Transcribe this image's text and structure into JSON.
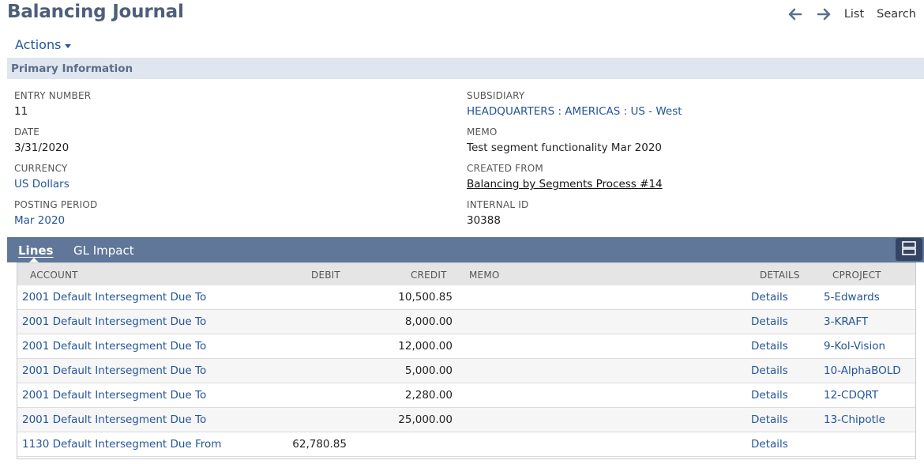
{
  "page": {
    "title": "Balancing Journal",
    "nav": {
      "back_icon": "arrow-left-icon",
      "forward_icon": "arrow-right-icon",
      "list": "List",
      "search": "Search"
    },
    "actions_label": "Actions"
  },
  "primary": {
    "header": "Primary Information",
    "left": [
      {
        "label": "ENTRY NUMBER",
        "value": "11"
      },
      {
        "label": "DATE",
        "value": "3/31/2020"
      },
      {
        "label": "CURRENCY",
        "value": "US Dollars"
      },
      {
        "label": "POSTING PERIOD",
        "value": "Mar 2020"
      }
    ],
    "right": [
      {
        "label": "SUBSIDIARY",
        "value": "HEADQUARTERS : AMERICAS : US - West"
      },
      {
        "label": "MEMO",
        "value": "Test segment functionality Mar 2020"
      },
      {
        "label": "CREATED FROM",
        "value": "Balancing by Segments Process #14"
      },
      {
        "label": "INTERNAL ID",
        "value": "30388"
      }
    ]
  },
  "tabs": {
    "lines": "Lines",
    "gl_impact": "GL Impact"
  },
  "lines": {
    "columns": [
      "ACCOUNT",
      "DEBIT",
      "CREDIT",
      "MEMO",
      "DETAILS",
      "CPROJECT"
    ],
    "rows": [
      {
        "account": "2001 Default Intersegment Due To",
        "debit": "",
        "credit": "10,500.85",
        "memo": "",
        "details": "Details",
        "cproject": "5-Edwards"
      },
      {
        "account": "2001 Default Intersegment Due To",
        "debit": "",
        "credit": "8,000.00",
        "memo": "",
        "details": "Details",
        "cproject": "3-KRAFT"
      },
      {
        "account": "2001 Default Intersegment Due To",
        "debit": "",
        "credit": "12,000.00",
        "memo": "",
        "details": "Details",
        "cproject": "9-Kol-Vision"
      },
      {
        "account": "2001 Default Intersegment Due To",
        "debit": "",
        "credit": "5,000.00",
        "memo": "",
        "details": "Details",
        "cproject": "10-AlphaBOLD"
      },
      {
        "account": "2001 Default Intersegment Due To",
        "debit": "",
        "credit": "2,280.00",
        "memo": "",
        "details": "Details",
        "cproject": "12-CDQRT"
      },
      {
        "account": "2001 Default Intersegment Due To",
        "debit": "",
        "credit": "25,000.00",
        "memo": "",
        "details": "Details",
        "cproject": "13-Chipotle"
      },
      {
        "account": "1130 Default Intersegment Due From",
        "debit": "62,780.85",
        "credit": "",
        "memo": "",
        "details": "Details",
        "cproject": ""
      }
    ]
  }
}
